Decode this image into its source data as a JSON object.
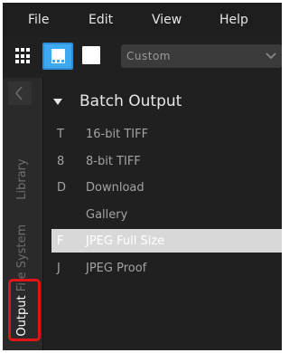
{
  "menu": {
    "file": "File",
    "edit": "Edit",
    "view": "View",
    "help": "Help"
  },
  "toolbar": {
    "view_modes": [
      "grid-view",
      "filmstrip-view",
      "single-view"
    ],
    "active_view": "filmstrip-view",
    "preset_select": {
      "value": "Custom"
    },
    "accent_color": "#3ea8f0"
  },
  "tabs": {
    "library": "Library",
    "file_system": "File System",
    "output": "Output",
    "active": "Output",
    "highlight_color": "#e01616"
  },
  "panel": {
    "title": "Batch Output",
    "items": [
      {
        "key": "T",
        "label": "16-bit TIFF",
        "selected": false
      },
      {
        "key": "8",
        "label": "8-bit TIFF",
        "selected": false
      },
      {
        "key": "D",
        "label": "Download",
        "selected": false
      },
      {
        "key": "",
        "label": "Gallery",
        "selected": false
      },
      {
        "key": "F",
        "label": "JPEG Full Size",
        "selected": true
      },
      {
        "key": "J",
        "label": "JPEG Proof",
        "selected": false
      }
    ]
  }
}
